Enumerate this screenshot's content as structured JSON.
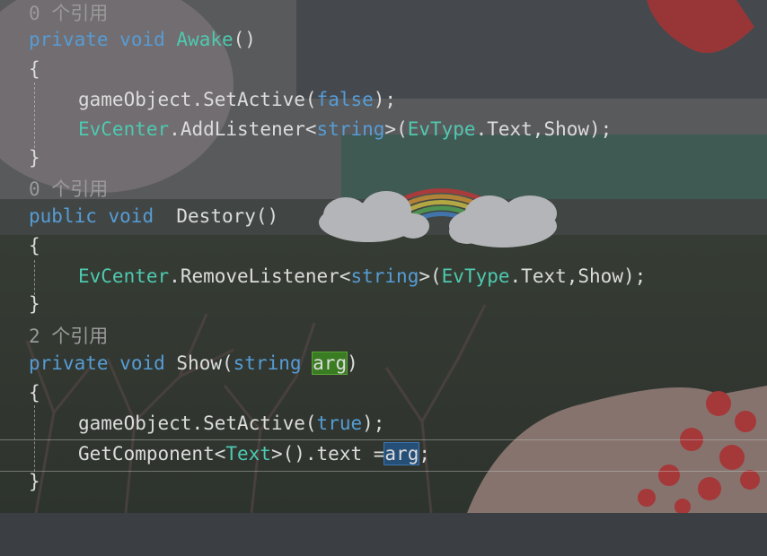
{
  "editor": {
    "blocks": [
      {
        "lens": "0 个引用",
        "signature": {
          "mod": "private",
          "ret": "void",
          "name": "Awake",
          "params": "()"
        },
        "open": "{",
        "body": [
          {
            "obj": "gameObject",
            "dot": ".",
            "call": "SetActive",
            "p1": "(",
            "arg": "false",
            "p2": ");"
          },
          {
            "cls": "EvCenter",
            "dot": ".",
            "call": "AddListener",
            "lt": "<",
            "generic": "string",
            "gt": ">",
            "p1": "(",
            "enumType": "EvType",
            "dot2": ".",
            "member": "Text,Show);"
          }
        ],
        "close": "}"
      },
      {
        "lens": "0 个引用",
        "signature": {
          "mod": "public",
          "ret": "void",
          "name": " Destory",
          "params": "()"
        },
        "open": "{",
        "body": [
          {
            "cls": "EvCenter",
            "dot": ".",
            "call": "RemoveListener",
            "lt": "<",
            "generic": "string",
            "gt": ">",
            "p1": "(",
            "enumType": "EvType",
            "dot2": ".",
            "member": "Text,Show);"
          }
        ],
        "close": "}"
      },
      {
        "lens": "2 个引用",
        "signature": {
          "mod": "private",
          "ret": "void",
          "name": "Show",
          "p1": "(",
          "ptype": "string",
          "pname": "arg",
          "p2": ")"
        },
        "open": "{",
        "body": [
          {
            "obj": "gameObject",
            "dot": ".",
            "call": "SetActive",
            "p1": "(",
            "arg": "true",
            "p2": ");"
          },
          {
            "call": "GetComponent",
            "lt": "<",
            "generic": "Text",
            "gt": ">",
            "rest": "().text =",
            "sel": "arg",
            "end": ";"
          }
        ],
        "close": "}"
      }
    ]
  },
  "colors": {
    "keyword": "#569cd6",
    "type": "#4ec9b0",
    "plain": "#dcdcdc",
    "codelens": "#9a9a9a",
    "reference_highlight": "#3a7c22",
    "selection": "#264f78"
  }
}
